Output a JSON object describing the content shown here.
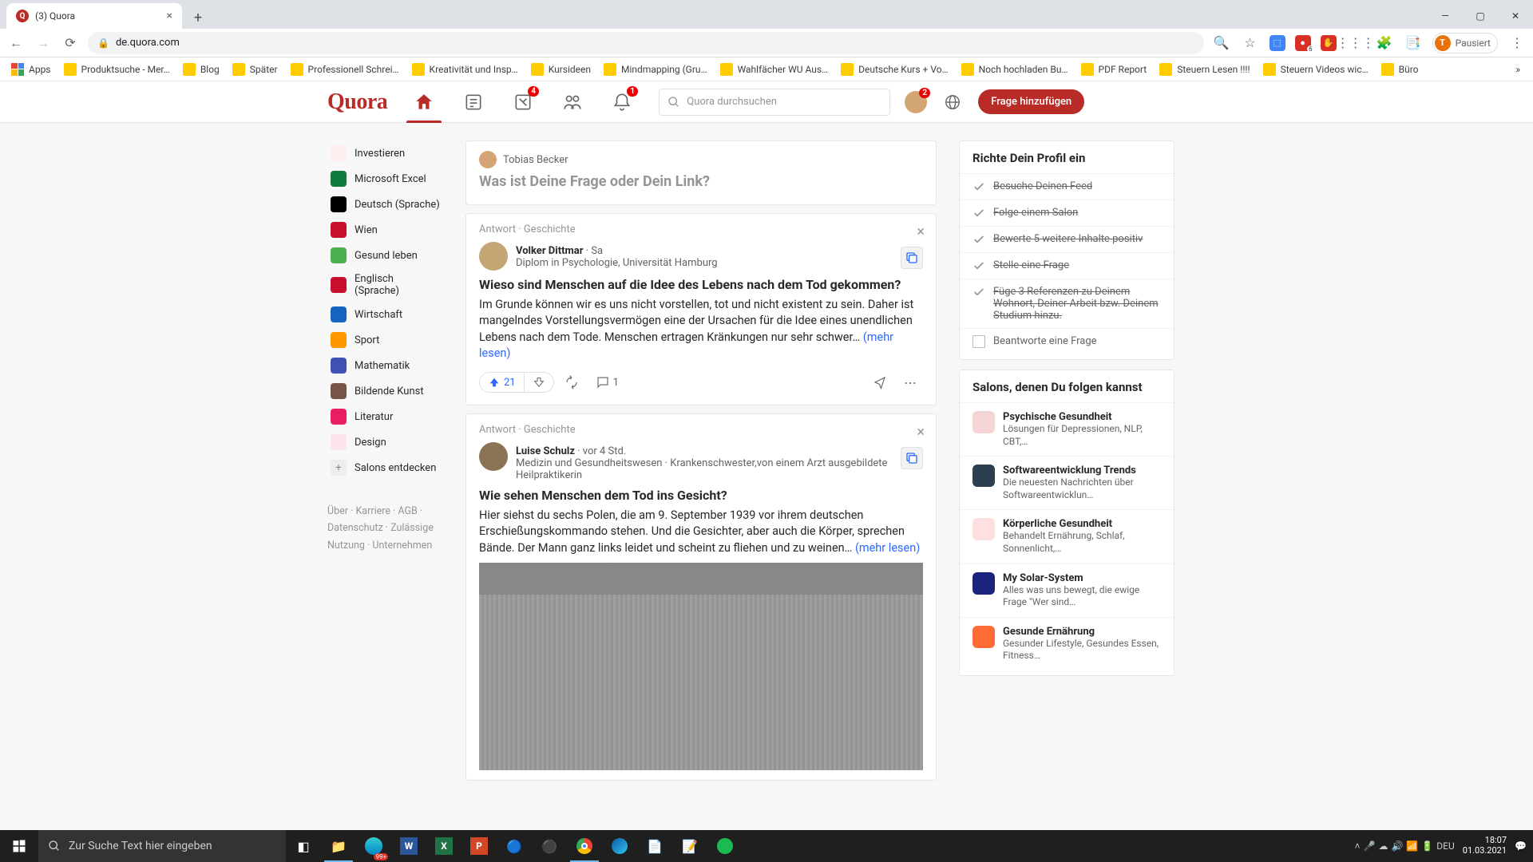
{
  "browser": {
    "tab_title": "(3) Quora",
    "url": "de.quora.com",
    "profile_status": "Pausiert",
    "bookmarks": [
      "Apps",
      "Produktsuche - Mer…",
      "Blog",
      "Später",
      "Professionell Schrei…",
      "Kreativität und Insp…",
      "Kursideen",
      "Mindmapping (Gru…",
      "Wahlfächer WU Aus…",
      "Deutsche Kurs + Vo…",
      "Noch hochladen Bu…",
      "PDF Report",
      "Steuern Lesen !!!!",
      "Steuern Videos wic…",
      "Büro"
    ]
  },
  "header": {
    "logo": "Quora",
    "search_placeholder": "Quora durchsuchen",
    "nav_badges": {
      "answer": "4",
      "notifications": "1",
      "avatar": "2"
    },
    "ask_button": "Frage hinzufügen"
  },
  "sidebar": {
    "topics": [
      "Investieren",
      "Microsoft Excel",
      "Deutsch (Sprache)",
      "Wien",
      "Gesund leben",
      "Englisch (Sprache)",
      "Wirtschaft",
      "Sport",
      "Mathematik",
      "Bildende Kunst",
      "Literatur",
      "Design"
    ],
    "discover": "Salons entdecken",
    "footer": "Über · Karriere · AGB · Datenschutz · Zulässige Nutzung · Unternehmen"
  },
  "ask_box": {
    "user": "Tobias Becker",
    "prompt": "Was ist Deine Frage oder Dein Link?"
  },
  "posts": [
    {
      "meta": "Antwort · Geschichte",
      "author": "Volker Dittmar",
      "time": " · Sa",
      "bio": "Diplom in Psychologie, Universität Hamburg",
      "title": "Wieso sind Menschen auf die Idee des Lebens nach dem Tod gekommen?",
      "body": "Im Grunde können wir es uns nicht vorstellen, tot und nicht existent zu sein. Daher ist mangelndes Vorstellungsvermögen eine der Ursachen für die Idee eines unendlichen Lebens nach dem Tode. Menschen ertragen Kränkungen nur sehr schwer…",
      "more": " (mehr lesen)",
      "upvotes": "21",
      "comments": "1"
    },
    {
      "meta": "Antwort · Geschichte",
      "author": "Luise Schulz",
      "time": " · vor 4 Std.",
      "bio": "Medizin und Gesundheitswesen · Krankenschwester,von einem Arzt ausgebildete Heilpraktikerin",
      "title": "Wie sehen Menschen dem Tod ins Gesicht?",
      "body": "Hier siehst du sechs Polen, die am 9. September 1939 vor ihrem deutschen Erschießungskommando stehen. Und die Gesichter, aber auch die Körper, sprechen Bände. Der Mann ganz links leidet und scheint zu fliehen und zu weinen…",
      "more": " (mehr lesen)"
    }
  ],
  "profile_card": {
    "title": "Richte Dein Profil ein",
    "items": [
      {
        "label": "Besuche Deinen Feed",
        "done": true
      },
      {
        "label": "Folge einem Salon",
        "done": true
      },
      {
        "label": "Bewerte 5 weitere Inhalte positiv",
        "done": true
      },
      {
        "label": "Stelle eine Frage",
        "done": true
      },
      {
        "label": "Füge 3 Referenzen zu Deinem Wohnort, Deiner Arbeit bzw. Deinem Studium hinzu.",
        "done": true
      },
      {
        "label": "Beantworte eine Frage",
        "done": false
      }
    ]
  },
  "spaces_card": {
    "title": "Salons, denen Du folgen kannst",
    "spaces": [
      {
        "name": "Psychische Gesundheit",
        "desc": "Lösungen für Depressionen, NLP, CBT,…"
      },
      {
        "name": "Softwareentwicklung Trends",
        "desc": "Die neuesten Nachrichten über Softwareentwicklun…"
      },
      {
        "name": "Körperliche Gesundheit",
        "desc": "Behandelt Ernährung, Schlaf, Sonnenlicht,…"
      },
      {
        "name": "My Solar-System",
        "desc": "Alles was uns bewegt, die ewige Frage \"Wer sind…"
      },
      {
        "name": "Gesunde Ernährung",
        "desc": "Gesunder Lifestyle, Gesundes Essen, Fitness…"
      }
    ]
  },
  "taskbar": {
    "search_placeholder": "Zur Suche Text hier eingeben",
    "tray_badge": "99+",
    "lang": "DEU",
    "time": "18:07",
    "date": "01.03.2021"
  }
}
